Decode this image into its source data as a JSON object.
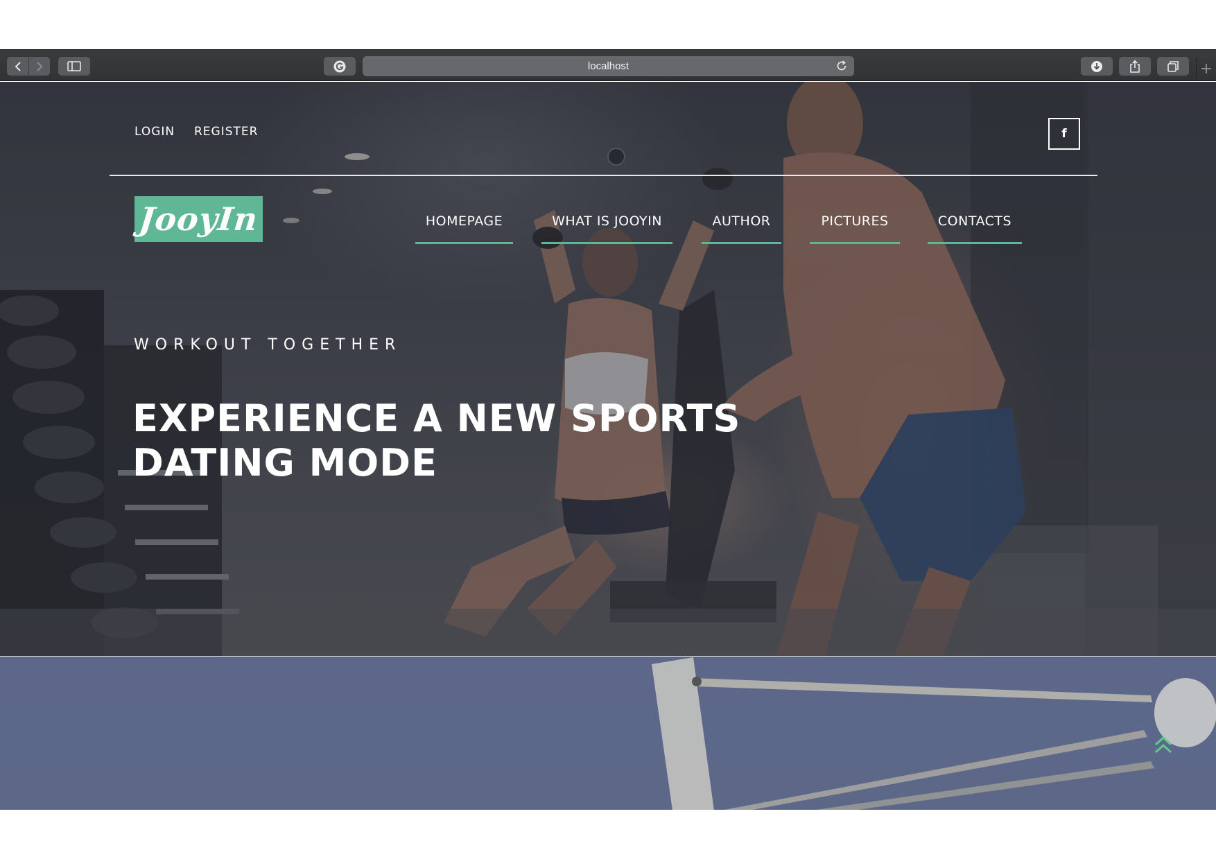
{
  "browser": {
    "url": "localhost",
    "icons": {
      "back": "chevron-left-icon",
      "forward": "chevron-right-icon",
      "sidebar": "sidebar-icon",
      "extension": "grammarly-icon",
      "reload": "reload-icon",
      "download": "download-icon",
      "share": "share-icon",
      "tabs": "tabs-overview-icon",
      "new_tab": "plus-icon"
    },
    "new_tab_glyph": "+"
  },
  "header": {
    "login": "LOGIN",
    "register": "REGISTER",
    "facebook": "f"
  },
  "logo": {
    "text": "JooyIn",
    "color": "#5fb796"
  },
  "nav": {
    "items": [
      {
        "label": "HOMEPAGE"
      },
      {
        "label": "WHAT IS JOOYIN"
      },
      {
        "label": "AUTHOR"
      },
      {
        "label": "PICTURES"
      },
      {
        "label": "CONTACTS"
      }
    ],
    "underline_color": "#5fb796"
  },
  "hero": {
    "eyebrow": "WORKOUT TOGETHER",
    "headline_line1": "EXPERIENCE A NEW SPORTS",
    "headline_line2": "DATING MODE"
  },
  "scroll_top": {
    "icon": "double-chevron-up-icon",
    "color": "#5fc98f"
  }
}
